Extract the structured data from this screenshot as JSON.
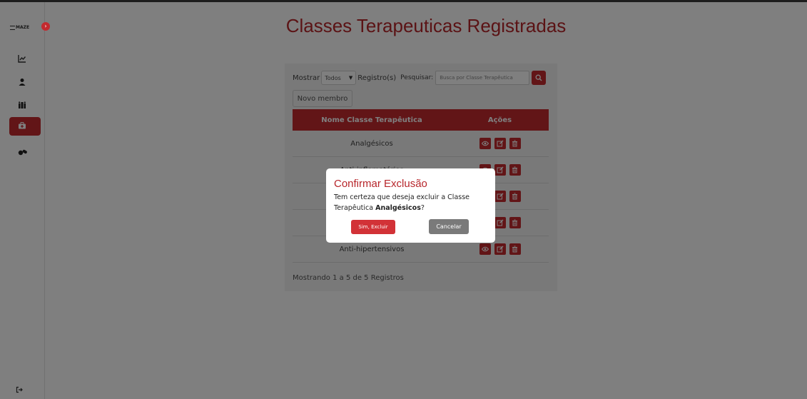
{
  "app": {
    "logo_text": "MAZE"
  },
  "sidebar": {
    "items": [
      {
        "icon": "chart-line-icon"
      },
      {
        "icon": "user-icon"
      },
      {
        "icon": "users-icon"
      },
      {
        "icon": "briefcase-medical-icon",
        "active": true
      },
      {
        "icon": "pills-icon"
      }
    ],
    "logout_icon": "sign-out-icon"
  },
  "page": {
    "title": "Classes Terapeuticas Registradas"
  },
  "toolbar": {
    "show_label": "Mostrar",
    "show_select_value": "Todos",
    "records_label": "Registro(s)",
    "search_label": "Pesquisar:",
    "search_placeholder": "Busca por Classe Terapêutica",
    "new_button": "Novo membro"
  },
  "table": {
    "headers": [
      "Nome Classe Terapêutica",
      "Ações"
    ],
    "rows": [
      {
        "name": "Analgésicos"
      },
      {
        "name": "Anti-inflamatórios"
      },
      {
        "name": ""
      },
      {
        "name": ""
      },
      {
        "name": "Anti-hipertensivos"
      }
    ]
  },
  "footer": {
    "summary": "Mostrando 1 a 5 de 5 Registros"
  },
  "modal": {
    "title": "Confirmar Exclusão",
    "message_before": "Tem certeza que deseja excluir a Classe Terapêutica ",
    "item_name": "Analgésicos",
    "message_after": "?",
    "confirm_label": "Sim, Excluir",
    "cancel_label": "Cancelar"
  },
  "colors": {
    "brand": "#c42a2f",
    "title": "#b7262b",
    "cancel": "#7a7a7a"
  }
}
